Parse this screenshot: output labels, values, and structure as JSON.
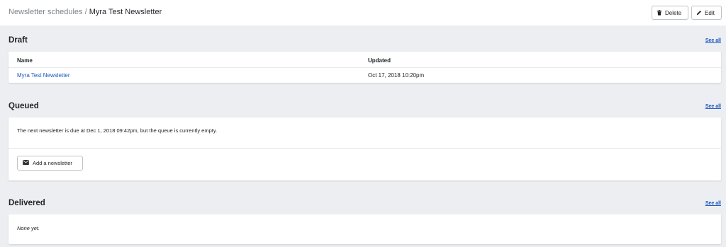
{
  "breadcrumb": {
    "parent": "Newsletter schedules",
    "separator": " / ",
    "current": "Myra Test Newsletter"
  },
  "toolbar": {
    "delete_label": "Delete",
    "edit_label": "Edit"
  },
  "draft": {
    "title": "Draft",
    "see_all": "See all",
    "columns": [
      "Name",
      "Updated"
    ],
    "rows": [
      {
        "name": "Myra Test Newsletter",
        "updated": "Oct 17, 2018 10:20pm"
      }
    ]
  },
  "queued": {
    "title": "Queued",
    "see_all": "See all",
    "message": "The next newsletter is due at Dec 1, 2018 09:42pm, but the queue is currently empty.",
    "add_label": "Add a newsletter"
  },
  "delivered": {
    "title": "Delivered",
    "see_all": "See all",
    "empty_text": "None yet."
  },
  "colors": {
    "link": "#1a57c0",
    "background": "#eceef1",
    "card": "#ffffff"
  },
  "icons": [
    "trash-icon",
    "pencil-icon",
    "envelope-icon"
  ]
}
